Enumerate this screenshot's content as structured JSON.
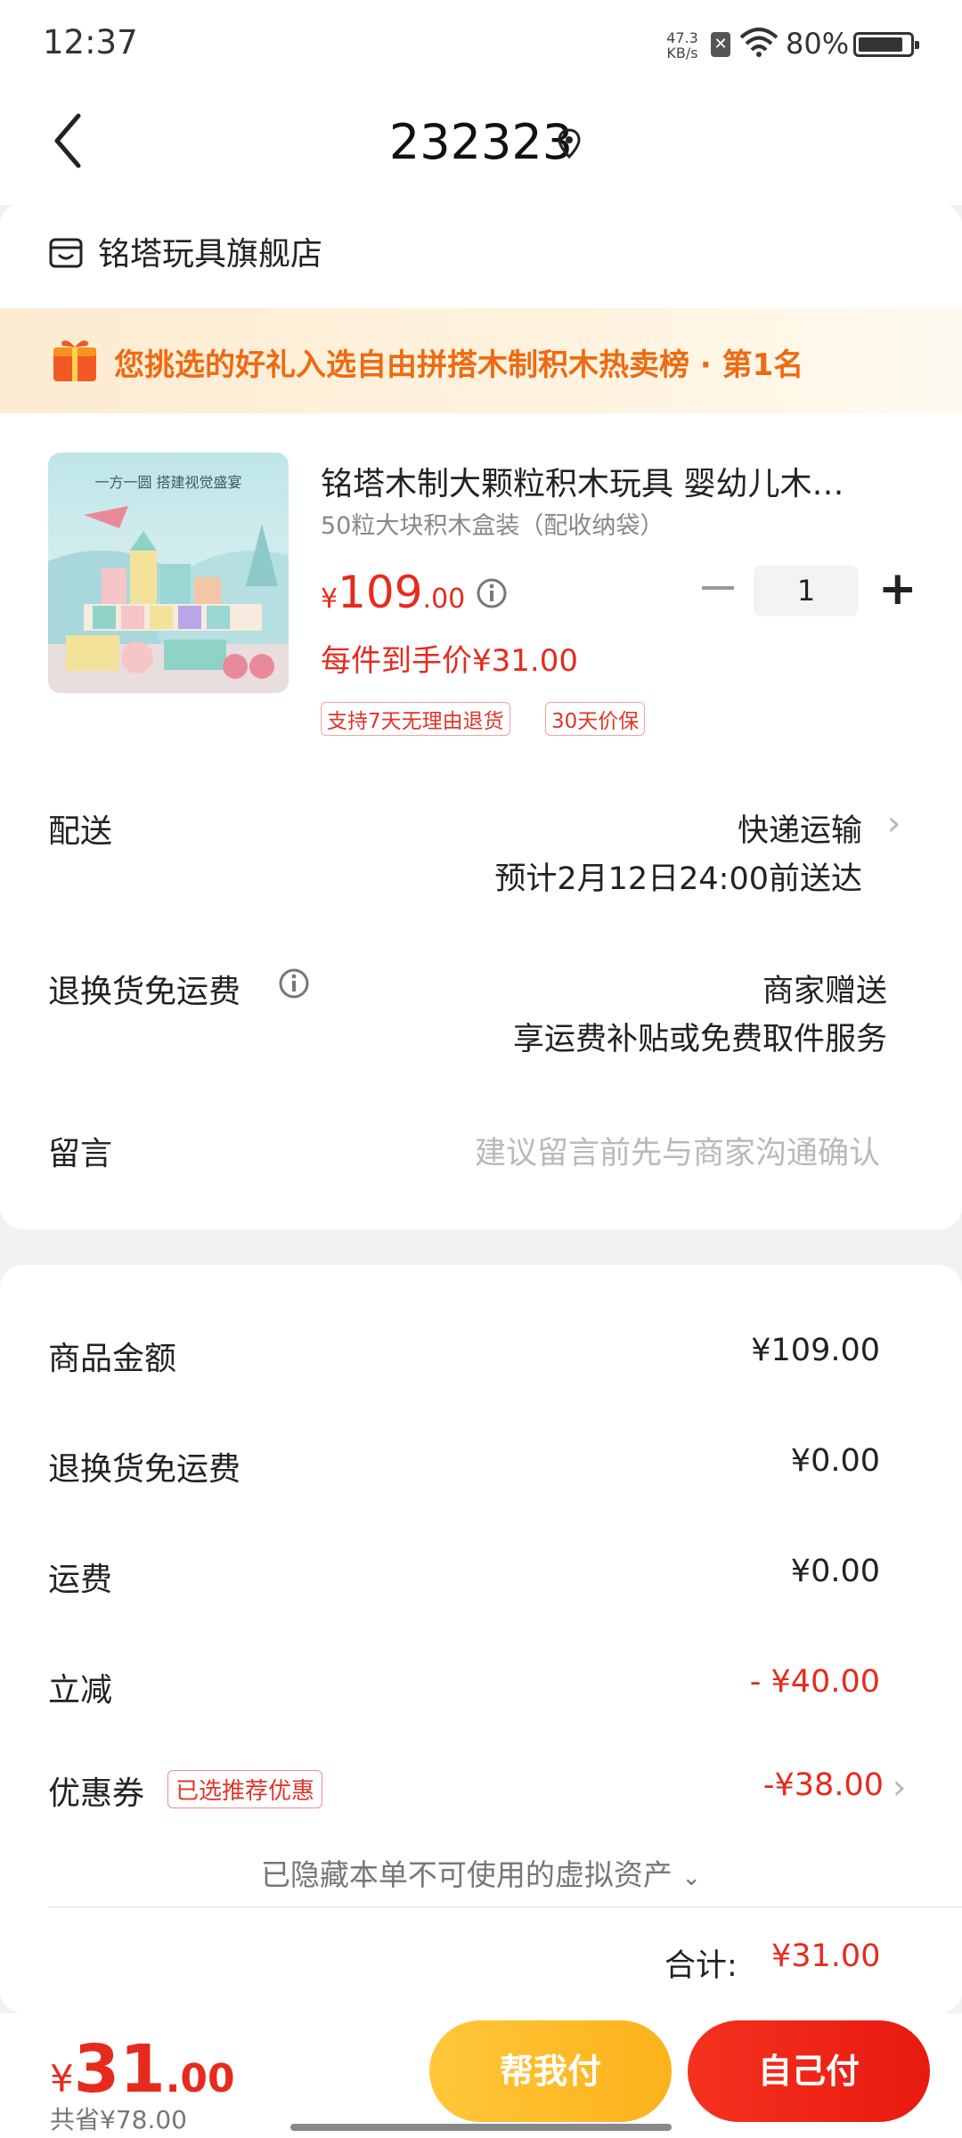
{
  "status_bar": {
    "time": "12:37",
    "net_speed_value": "47.3",
    "net_speed_unit": "KB/s",
    "battery": "80%"
  },
  "header": {
    "title": "232323"
  },
  "store": {
    "name": "铭塔玩具旗舰店"
  },
  "banner": {
    "text": "您挑选的好礼入选自由拼搭木制积木热卖榜 · 第1名"
  },
  "product": {
    "image_caption": "一方一圆 搭建视觉盛宴",
    "title": "铭塔木制大颗粒积木玩具 婴幼儿木…",
    "spec": "50粒大块积木盒装（配收纳袋）",
    "price_symbol": "¥",
    "price_int": "109",
    "price_dec": ".00",
    "quantity": "1",
    "unit_price": "每件到手价¥31.00",
    "tags": [
      "支持7天无理由退货",
      "30天价保"
    ]
  },
  "delivery": {
    "label": "配送",
    "method": "快递运输",
    "eta": "预计2月12日24:00前送达"
  },
  "return_freight": {
    "label": "退换货免运费",
    "value": "商家赠送",
    "desc": "享运费补贴或免费取件服务"
  },
  "message": {
    "label": "留言",
    "placeholder": "建议留言前先与商家沟通确认"
  },
  "summary": {
    "goods_label": "商品金额",
    "goods_value": "¥109.00",
    "return_label": "退换货免运费",
    "return_value": "¥0.00",
    "shipping_label": "运费",
    "shipping_value": "¥0.00",
    "discount_label": "立减",
    "discount_value": "- ¥40.00",
    "coupon_label": "优惠券",
    "coupon_tag": "已选推荐优惠",
    "coupon_value": "-¥38.00",
    "hidden_note": "已隐藏本单不可使用的虚拟资产",
    "total_label": "合计:",
    "total_value": "¥31.00"
  },
  "bottom": {
    "price_symbol": "¥",
    "price_int": "31",
    "price_dec": ".00",
    "saved": "共省¥78.00",
    "help_pay": "帮我付",
    "self_pay": "自己付"
  },
  "colors": {
    "accent_red": "#e62b1e",
    "banner_orange": "#ee6a12",
    "help_button": "#fcb21a"
  }
}
